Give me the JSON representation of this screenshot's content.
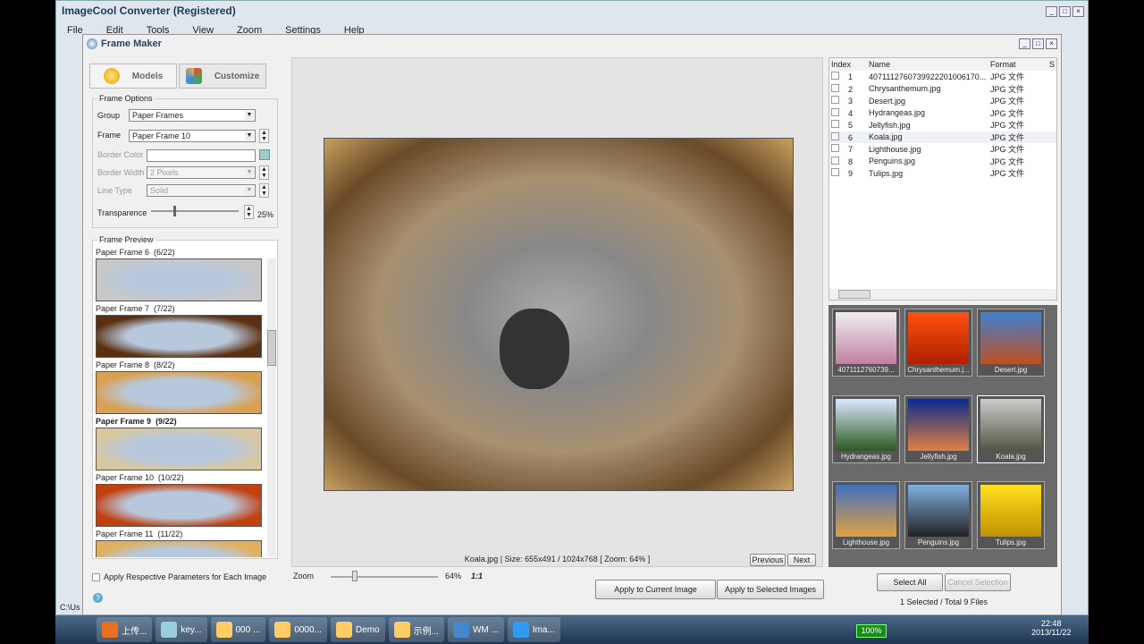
{
  "app": {
    "title": "ImageCool Converter  (Registered)",
    "menu": [
      "File",
      "Edit",
      "Tools",
      "View",
      "Zoom",
      "Settings",
      "Help"
    ],
    "path": "C:\\Us"
  },
  "dialog": {
    "title": "Frame Maker",
    "tabs": [
      "Models",
      "Customize"
    ],
    "options": {
      "legend": "Frame Options",
      "group_label": "Group",
      "group_value": "Paper Frames",
      "frame_label": "Frame",
      "frame_value": "Paper Frame 10",
      "border_color_label": "Border Color",
      "border_width_label": "Border Width",
      "border_width_value": "2 Pixels",
      "line_type_label": "Line Type",
      "line_type_value": "Solid",
      "transparence_label": "Transparence",
      "transparence_value": "25%",
      "transparence_fraction": 0.25
    },
    "preview": {
      "legend": "Frame Preview",
      "items": [
        {
          "label": "Paper Frame 6",
          "count": "(6/22)"
        },
        {
          "label": "Paper Frame 7",
          "count": "(7/22)"
        },
        {
          "label": "Paper Frame 8",
          "count": "(8/22)"
        },
        {
          "label": "Paper Frame 9",
          "count": "(9/22)"
        },
        {
          "label": "Paper Frame 10",
          "count": "(10/22)"
        },
        {
          "label": "Paper Frame 11",
          "count": "(11/22)"
        }
      ]
    },
    "apply_each": "Apply Respective Parameters for Each Image",
    "status": "Koala.jpg  |  Size: 655x491 / 1024x768 [ Zoom: 64% ]",
    "previous": "Previous",
    "next": "Next",
    "zoom_label": "Zoom",
    "zoom_value": "64%",
    "zoom_fraction": 0.2,
    "one_to_one": "1:1",
    "apply_current": "Apply to Current Image",
    "apply_selected": "Apply to Selected Images",
    "select_all": "Select All",
    "cancel_selection": "Cancel Selection",
    "selection_status": "1 Selected / Total 9 Files"
  },
  "files": {
    "columns": [
      "Index",
      "Name",
      "Format",
      "S"
    ],
    "rows": [
      {
        "i": "1",
        "name": "40711127607399222010061​70...",
        "fmt": "JPG 文件",
        "thumb": "4071112760739...",
        "c1": "#f0eef0",
        "c2": "#c080a0"
      },
      {
        "i": "2",
        "name": "Chrysanthemum.jpg",
        "fmt": "JPG 文件",
        "thumb": "Chrysanthemum.j...",
        "c1": "#ff5010",
        "c2": "#b02000"
      },
      {
        "i": "3",
        "name": "Desert.jpg",
        "fmt": "JPG 文件",
        "thumb": "Desert.jpg",
        "c1": "#4080d0",
        "c2": "#c05020"
      },
      {
        "i": "4",
        "name": "Hydrangeas.jpg",
        "fmt": "JPG 文件",
        "thumb": "Hydrangeas.jpg",
        "c1": "#dde8ff",
        "c2": "#2a5a20"
      },
      {
        "i": "5",
        "name": "Jellyfish.jpg",
        "fmt": "JPG 文件",
        "thumb": "Jellyfish.jpg",
        "c1": "#0a2a90",
        "c2": "#e08040"
      },
      {
        "i": "6",
        "name": "Koala.jpg",
        "fmt": "JPG 文件",
        "thumb": "Koala.jpg",
        "c1": "#ccc",
        "c2": "#554"
      },
      {
        "i": "7",
        "name": "Lighthouse.jpg",
        "fmt": "JPG 文件",
        "thumb": "Lighthouse.jpg",
        "c1": "#4070c0",
        "c2": "#e0a040"
      },
      {
        "i": "8",
        "name": "Penguins.jpg",
        "fmt": "JPG 文件",
        "thumb": "Penguins.jpg",
        "c1": "#80b0e0",
        "c2": "#222"
      },
      {
        "i": "9",
        "name": "Tulips.jpg",
        "fmt": "JPG 文件",
        "thumb": "Tulips.jpg",
        "c1": "#ffe020",
        "c2": "#c09000"
      }
    ]
  },
  "taskbar": {
    "items": [
      "上传...",
      "key...",
      "000 ...",
      "0000...",
      "Demo",
      "示例...",
      "WM ...",
      "Ima..."
    ],
    "battery": "100%",
    "time": "22:48",
    "date": "2013/11/22"
  }
}
